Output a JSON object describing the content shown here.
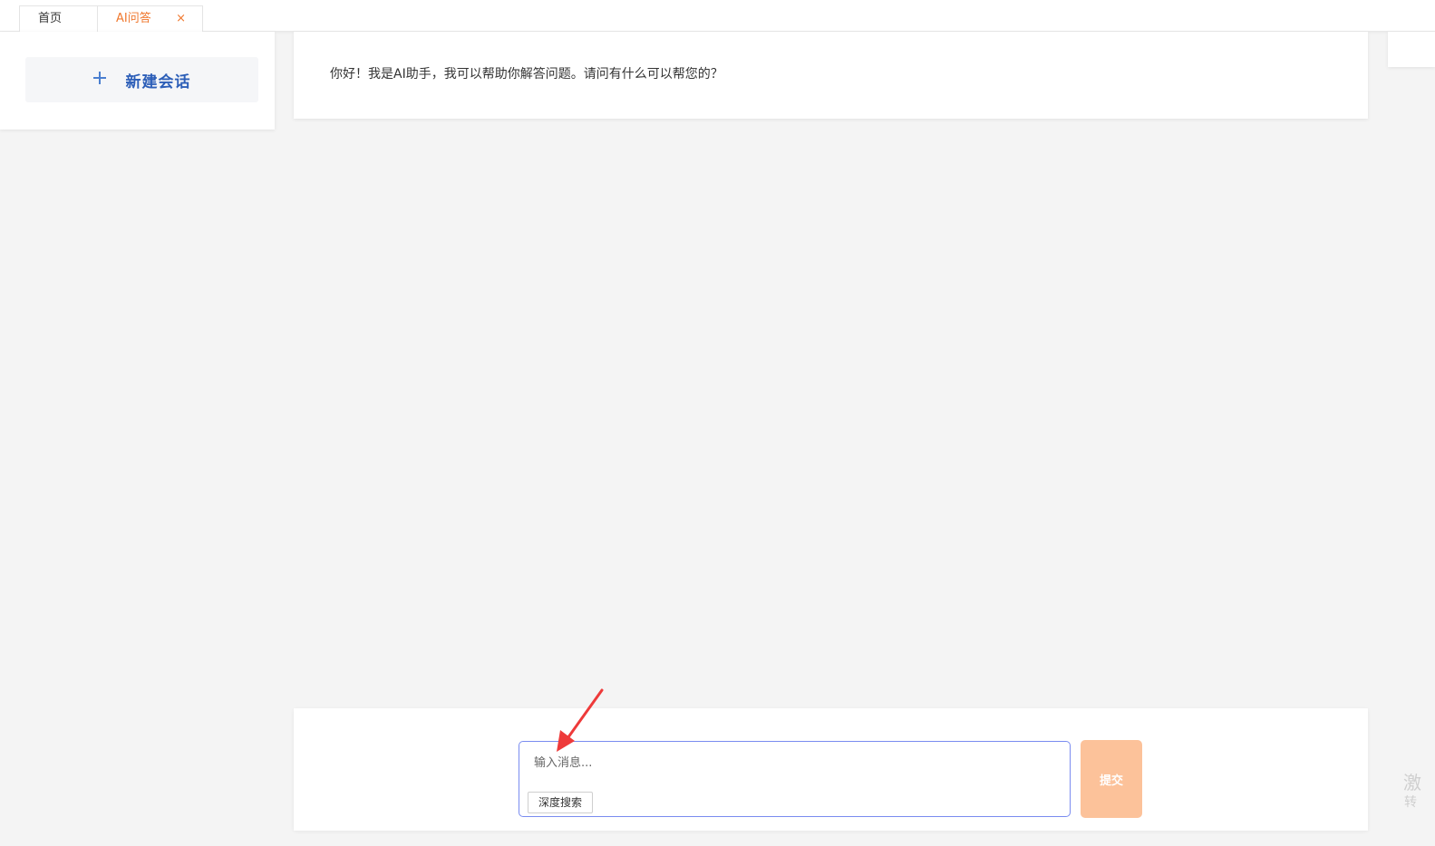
{
  "tabs": {
    "home_label": "首页",
    "ai_label": "AI问答",
    "close_glyph": "×"
  },
  "sidebar": {
    "new_chat_label": "新建会话"
  },
  "chat": {
    "greeting": "你好！我是AI助手，我可以帮助你解答问题。请问有什么可以帮您的？"
  },
  "composer": {
    "placeholder": "输入消息...",
    "deep_search_label": "深度搜索",
    "submit_label": "提交"
  },
  "watermark": {
    "line1": "激",
    "line2": "转"
  },
  "colors": {
    "accent": "#f0782e",
    "link_blue": "#2d5fb8",
    "submit_bg": "#fcc29a",
    "input_border": "#7a8cf0",
    "annotation_red": "#ee3a3a"
  }
}
